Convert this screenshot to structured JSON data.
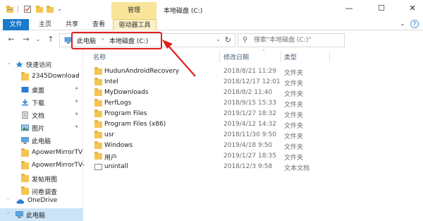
{
  "window": {
    "title": "本地磁盘 (C:)",
    "context_tab": "管理",
    "minimize_glyph": "—",
    "maximize_glyph": "☐",
    "close_glyph": "✕"
  },
  "ribbon": {
    "tabs": [
      "文件",
      "主页",
      "共享",
      "查看",
      "驱动器工具"
    ],
    "expand_glyph": "⌄",
    "help_glyph": "?"
  },
  "nav": {
    "back_glyph": "←",
    "forward_glyph": "→",
    "recent_glyph": "⌄",
    "up_glyph": "↑",
    "address": {
      "crumb1": "此电脑",
      "sep": "›",
      "crumb2": "本地磁盘 (C:)",
      "dropdown_glyph": "⌄",
      "refresh_glyph": "↻"
    },
    "search_placeholder": "搜索\"本地磁盘 (C:)\""
  },
  "columns": {
    "name": "名称",
    "modified": "修改日期",
    "type": "类型"
  },
  "sidebar": {
    "quick_access": "快速访问",
    "items": [
      {
        "label": "2345Download",
        "icon": "folder-icon",
        "pinned": true
      },
      {
        "label": "桌面",
        "icon": "desktop-icon",
        "pinned": true
      },
      {
        "label": "下载",
        "icon": "download-icon",
        "pinned": true
      },
      {
        "label": "文档",
        "icon": "document-icon",
        "pinned": true
      },
      {
        "label": "图片",
        "icon": "pictures-icon",
        "pinned": true
      },
      {
        "label": "此电脑",
        "icon": "computer-icon",
        "pinned": false
      },
      {
        "label": "ApowerMirrorTV",
        "icon": "folder-icon",
        "pinned": false
      },
      {
        "label": "ApowerMirrorTV-",
        "icon": "folder-icon",
        "pinned": false
      },
      {
        "label": "发帖用图",
        "icon": "folder-icon",
        "pinned": false
      },
      {
        "label": "问卷调查",
        "icon": "folder-icon",
        "pinned": false
      }
    ],
    "onedrive": "OneDrive",
    "this_pc": "此电脑",
    "pin_glyph": "✦"
  },
  "files": [
    {
      "name": "HudunAndroidRecovery",
      "date": "2018/8/21 11:29",
      "type": "文件夹",
      "kind": "folder"
    },
    {
      "name": "Intel",
      "date": "2018/12/17 12:01",
      "type": "文件夹",
      "kind": "folder"
    },
    {
      "name": "MyDownloads",
      "date": "2018/8/2 11:40",
      "type": "文件夹",
      "kind": "folder"
    },
    {
      "name": "PerfLogs",
      "date": "2018/9/15 15:33",
      "type": "文件夹",
      "kind": "folder"
    },
    {
      "name": "Program Files",
      "date": "2019/1/27 18:32",
      "type": "文件夹",
      "kind": "folder"
    },
    {
      "name": "Program Files (x86)",
      "date": "2019/4/12 14:32",
      "type": "文件夹",
      "kind": "folder"
    },
    {
      "name": "usr",
      "date": "2018/11/30 9:50",
      "type": "文件夹",
      "kind": "folder"
    },
    {
      "name": "Windows",
      "date": "2019/4/18 9:50",
      "type": "文件夹",
      "kind": "folder"
    },
    {
      "name": "用户",
      "date": "2019/1/27 18:35",
      "type": "文件夹",
      "kind": "folder"
    },
    {
      "name": "unintall",
      "date": "2018/12/3 9:58",
      "type": "文本文档",
      "kind": "text"
    }
  ],
  "colors": {
    "file_tab": "#1979ca",
    "manage_tab": "#f8e59a",
    "highlight_box": "#e0201f",
    "annotation_arrow": "#e0201f",
    "selected_sidebar": "#cce4f7",
    "folder": "#f3c552"
  }
}
